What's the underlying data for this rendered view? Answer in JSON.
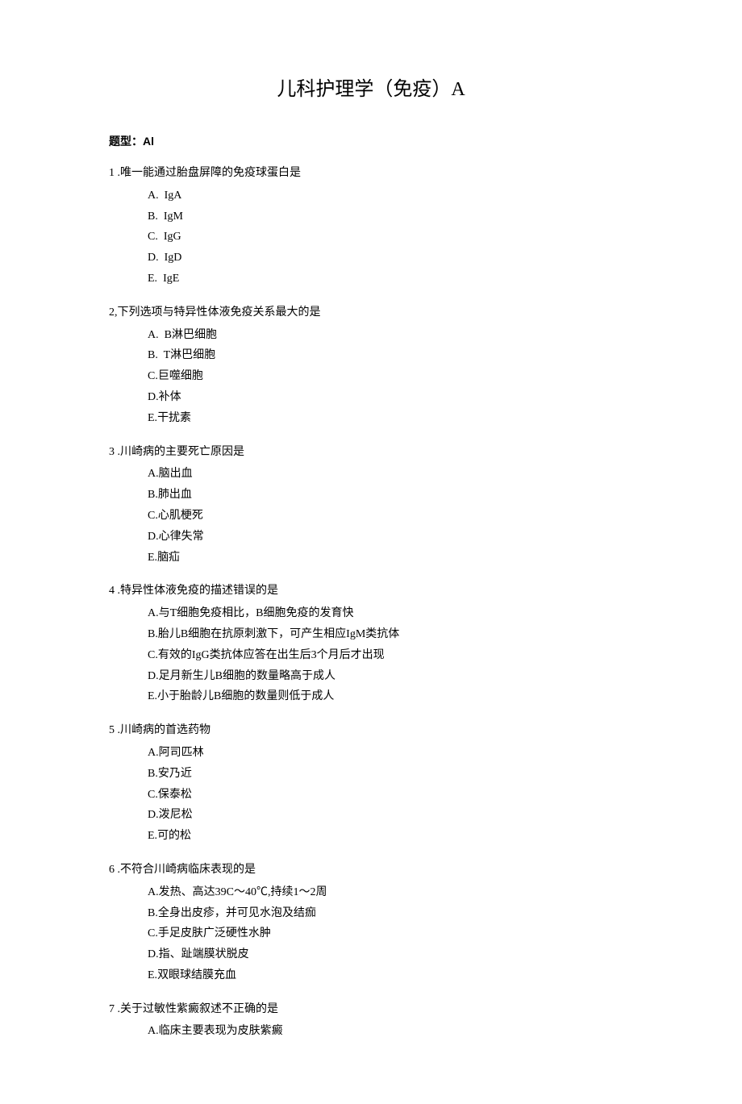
{
  "title": "儿科护理学（免疫）A",
  "sectionLabel": "题型：Al",
  "questions": [
    {
      "number": "1",
      "sep": " ",
      "stem": ".唯一能通过胎盘屏障的免疫球蛋白是",
      "options": [
        {
          "letter": "A.",
          "gap": "  ",
          "text": "IgA"
        },
        {
          "letter": "B.",
          "gap": "  ",
          "text": "IgM"
        },
        {
          "letter": "C.",
          "gap": "  ",
          "text": "IgG"
        },
        {
          "letter": "D.",
          "gap": "  ",
          "text": "IgD"
        },
        {
          "letter": "E.",
          "gap": "  ",
          "text": "IgE"
        }
      ]
    },
    {
      "number": "2",
      "sep": ",",
      "stem": "下列选项与特异性体液免疫关系最大的是",
      "options": [
        {
          "letter": "A.",
          "gap": "  ",
          "text": "B淋巴细胞"
        },
        {
          "letter": "B.",
          "gap": "  ",
          "text": "T淋巴细胞"
        },
        {
          "letter": "C.",
          "gap": "",
          "text": "巨噬细胞"
        },
        {
          "letter": "D.",
          "gap": "",
          "text": "补体"
        },
        {
          "letter": "E.",
          "gap": "",
          "text": "干扰素"
        }
      ]
    },
    {
      "number": "3",
      "sep": " ",
      "stem": ".川崎病的主要死亡原因是",
      "options": [
        {
          "letter": "A.",
          "gap": "",
          "text": "脑出血"
        },
        {
          "letter": "B.",
          "gap": "",
          "text": "肺出血"
        },
        {
          "letter": "C.",
          "gap": "",
          "text": "心肌梗死"
        },
        {
          "letter": "D.",
          "gap": "",
          "text": "心律失常"
        },
        {
          "letter": "E.",
          "gap": "",
          "text": "脑疝"
        }
      ]
    },
    {
      "number": "4",
      "sep": " ",
      "stem": ".特异性体液免疫的描述错误的是",
      "options": [
        {
          "letter": "A.",
          "gap": "",
          "text": "与T细胞免疫相比，B细胞免疫的发育快"
        },
        {
          "letter": "B.",
          "gap": "",
          "text": "胎儿B细胞在抗原刺激下，可产生相应IgM类抗体"
        },
        {
          "letter": "C.",
          "gap": "",
          "text": "有效的IgG类抗体应答在出生后3个月后才出现"
        },
        {
          "letter": "D.",
          "gap": "",
          "text": "足月新生儿B细胞的数量略高于成人"
        },
        {
          "letter": "E.",
          "gap": "",
          "text": "小于胎龄儿B细胞的数量则低于成人"
        }
      ]
    },
    {
      "number": "5",
      "sep": " ",
      "stem": ".川崎病的首选药物",
      "options": [
        {
          "letter": "A.",
          "gap": "",
          "text": "阿司匹林"
        },
        {
          "letter": "B.",
          "gap": "",
          "text": "安乃近"
        },
        {
          "letter": "C.",
          "gap": "",
          "text": "保泰松"
        },
        {
          "letter": "D.",
          "gap": "",
          "text": "泼尼松"
        },
        {
          "letter": "E.",
          "gap": "",
          "text": "可的松"
        }
      ]
    },
    {
      "number": "6",
      "sep": " ",
      "stem": ".不符合川崎病临床表现的是",
      "options": [
        {
          "letter": "A.",
          "gap": "",
          "text": "发热、高达39C～40℃,持续1～2周"
        },
        {
          "letter": "B.",
          "gap": "",
          "text": "全身出皮疹，并可见水泡及结痂"
        },
        {
          "letter": "C.",
          "gap": "",
          "text": "手足皮肤广泛硬性水肿"
        },
        {
          "letter": "D.",
          "gap": "",
          "text": "指、趾端膜状脱皮"
        },
        {
          "letter": "E.",
          "gap": "",
          "text": "双眼球结膜充血"
        }
      ]
    },
    {
      "number": "7",
      "sep": " ",
      "stem": ".关于过敏性紫癜叙述不正确的是",
      "options": [
        {
          "letter": "A.",
          "gap": "",
          "text": "临床主要表现为皮肤紫癜"
        }
      ]
    }
  ]
}
